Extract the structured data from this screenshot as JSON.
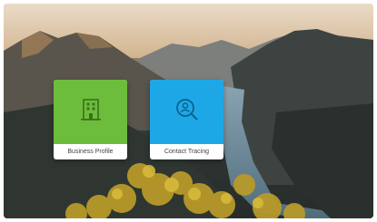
{
  "tiles": [
    {
      "label": "Business Profile",
      "icon": "building-icon",
      "color": "#6cbd3b"
    },
    {
      "label": "Contact Tracing",
      "icon": "search-person-icon",
      "color": "#1ea7e6"
    }
  ]
}
